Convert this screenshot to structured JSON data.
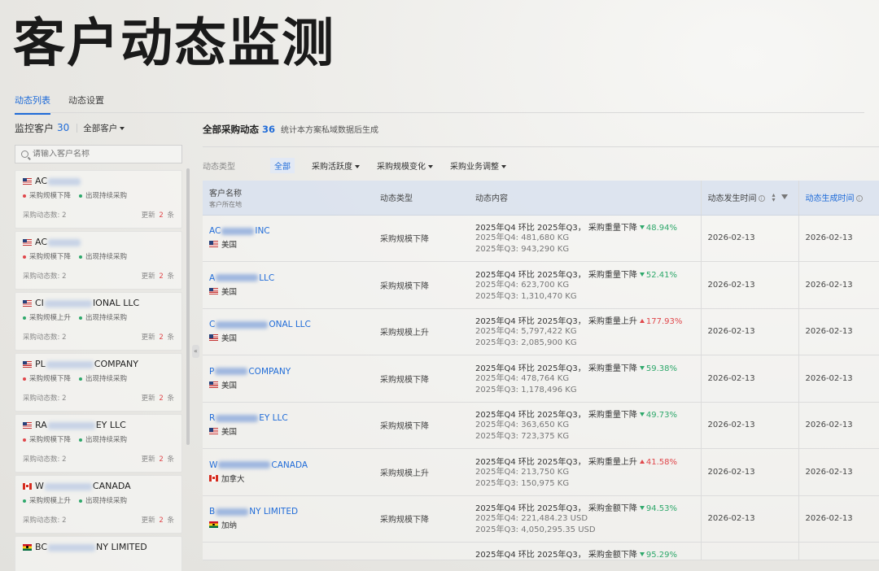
{
  "page_title": "客户动态监测",
  "tabs": [
    {
      "label": "动态列表",
      "active": true
    },
    {
      "label": "动态设置",
      "active": false
    }
  ],
  "left": {
    "monitor_label": "监控客户",
    "monitor_count": "30",
    "filter_label": "全部客户",
    "search_placeholder": "请输入客户名称",
    "cards": [
      {
        "flag": "us",
        "name_start": "AC",
        "name_end": "",
        "tag_a": "采购规模下降",
        "tag_a_color": "red",
        "tag_b": "出现持续采购",
        "count_label": "采购动态数: 2",
        "update_prefix": "更新",
        "update_count": "2",
        "update_suffix": "条"
      },
      {
        "flag": "us",
        "name_start": "AC",
        "name_end": "",
        "tag_a": "采购规模下降",
        "tag_a_color": "red",
        "tag_b": "出现持续采购",
        "count_label": "采购动态数: 2",
        "update_prefix": "更新",
        "update_count": "2",
        "update_suffix": "条"
      },
      {
        "flag": "us",
        "name_start": "CI",
        "name_end": "IONAL LLC",
        "tag_a": "采购规模上升",
        "tag_a_color": "green",
        "tag_b": "出现持续采购",
        "count_label": "采购动态数: 2",
        "update_prefix": "更新",
        "update_count": "2",
        "update_suffix": "条"
      },
      {
        "flag": "us",
        "name_start": "PL",
        "name_end": "COMPANY",
        "tag_a": "采购规模下降",
        "tag_a_color": "red",
        "tag_b": "出现持续采购",
        "count_label": "采购动态数: 2",
        "update_prefix": "更新",
        "update_count": "2",
        "update_suffix": "条"
      },
      {
        "flag": "us",
        "name_start": "RA",
        "name_end": "EY LLC",
        "tag_a": "采购规模下降",
        "tag_a_color": "red",
        "tag_b": "出现持续采购",
        "count_label": "采购动态数: 2",
        "update_prefix": "更新",
        "update_count": "2",
        "update_suffix": "条"
      },
      {
        "flag": "ca",
        "name_start": "W",
        "name_end": "CANADA",
        "tag_a": "采购规模上升",
        "tag_a_color": "green",
        "tag_b": "出现持续采购",
        "count_label": "采购动态数: 2",
        "update_prefix": "更新",
        "update_count": "2",
        "update_suffix": "条"
      },
      {
        "flag": "gh",
        "name_start": "BC",
        "name_end": "NY LIMITED",
        "tag_a": "",
        "tag_a_color": "red",
        "tag_b": "",
        "count_label": "",
        "update_prefix": "",
        "update_count": "",
        "update_suffix": ""
      }
    ]
  },
  "right": {
    "heading": "全部采购动态",
    "heading_count": "36",
    "heading_desc": "统计本方案私域数据后生成",
    "filter_label": "动态类型",
    "filters": [
      "全部",
      "采购活跃度",
      "采购规模变化",
      "采购业务调整"
    ],
    "columns": {
      "name": "客户名称",
      "name_sub": "客户所在地",
      "type": "动态类型",
      "content": "动态内容",
      "occur": "动态发生时间",
      "gen": "动态生成时间"
    },
    "rows": [
      {
        "flag": "us",
        "name_start": "AC",
        "name_end": "INC",
        "country": "美国",
        "type": "采购规模下降",
        "line": "2025年Q4 环比 2025年Q3， 采购重量下降",
        "dir": "down",
        "pct": "48.94%",
        "q4": "2025年Q4: 481,680 KG",
        "q3": "2025年Q3: 943,290 KG",
        "occur": "2026-02-13",
        "gen": "2026-02-13"
      },
      {
        "flag": "us",
        "name_start": "A",
        "name_end": "LLC",
        "country": "美国",
        "type": "采购规模下降",
        "line": "2025年Q4 环比 2025年Q3， 采购重量下降",
        "dir": "down",
        "pct": "52.41%",
        "q4": "2025年Q4: 623,700 KG",
        "q3": "2025年Q3: 1,310,470 KG",
        "occur": "2026-02-13",
        "gen": "2026-02-13"
      },
      {
        "flag": "us",
        "name_start": "C",
        "name_end": "ONAL LLC",
        "country": "美国",
        "type": "采购规模上升",
        "line": "2025年Q4 环比 2025年Q3， 采购重量上升",
        "dir": "up",
        "pct": "177.93%",
        "q4": "2025年Q4: 5,797,422 KG",
        "q3": "2025年Q3: 2,085,900 KG",
        "occur": "2026-02-13",
        "gen": "2026-02-13"
      },
      {
        "flag": "us",
        "name_start": "P",
        "name_end": "COMPANY",
        "country": "美国",
        "type": "采购规模下降",
        "line": "2025年Q4 环比 2025年Q3， 采购重量下降",
        "dir": "down",
        "pct": "59.38%",
        "q4": "2025年Q4: 478,764 KG",
        "q3": "2025年Q3: 1,178,496 KG",
        "occur": "2026-02-13",
        "gen": "2026-02-13"
      },
      {
        "flag": "us",
        "name_start": "R",
        "name_end": "EY LLC",
        "country": "美国",
        "type": "采购规模下降",
        "line": "2025年Q4 环比 2025年Q3， 采购重量下降",
        "dir": "down",
        "pct": "49.73%",
        "q4": "2025年Q4: 363,650 KG",
        "q3": "2025年Q3: 723,375 KG",
        "occur": "2026-02-13",
        "gen": "2026-02-13"
      },
      {
        "flag": "ca",
        "name_start": "W",
        "name_end": "CANADA",
        "country": "加拿大",
        "type": "采购规模上升",
        "line": "2025年Q4 环比 2025年Q3， 采购重量上升",
        "dir": "up",
        "pct": "41.58%",
        "q4": "2025年Q4: 213,750 KG",
        "q3": "2025年Q3: 150,975 KG",
        "occur": "2026-02-13",
        "gen": "2026-02-13"
      },
      {
        "flag": "gh",
        "name_start": "B",
        "name_end": "NY LIMITED",
        "country": "加纳",
        "type": "采购规模下降",
        "line": "2025年Q4 环比 2025年Q3， 采购金额下降",
        "dir": "down",
        "pct": "94.53%",
        "q4": "2025年Q4: 221,484.23 USD",
        "q3": "2025年Q3: 4,050,295.35 USD",
        "occur": "2026-02-13",
        "gen": "2026-02-13"
      }
    ],
    "partial_row": {
      "line": "2025年Q4 环比 2025年Q3， 采购金额下降",
      "pct": "95.29%"
    }
  },
  "colors": {
    "accent": "#1f6bd8",
    "up": "#e0474b",
    "down": "#2ea86b"
  }
}
